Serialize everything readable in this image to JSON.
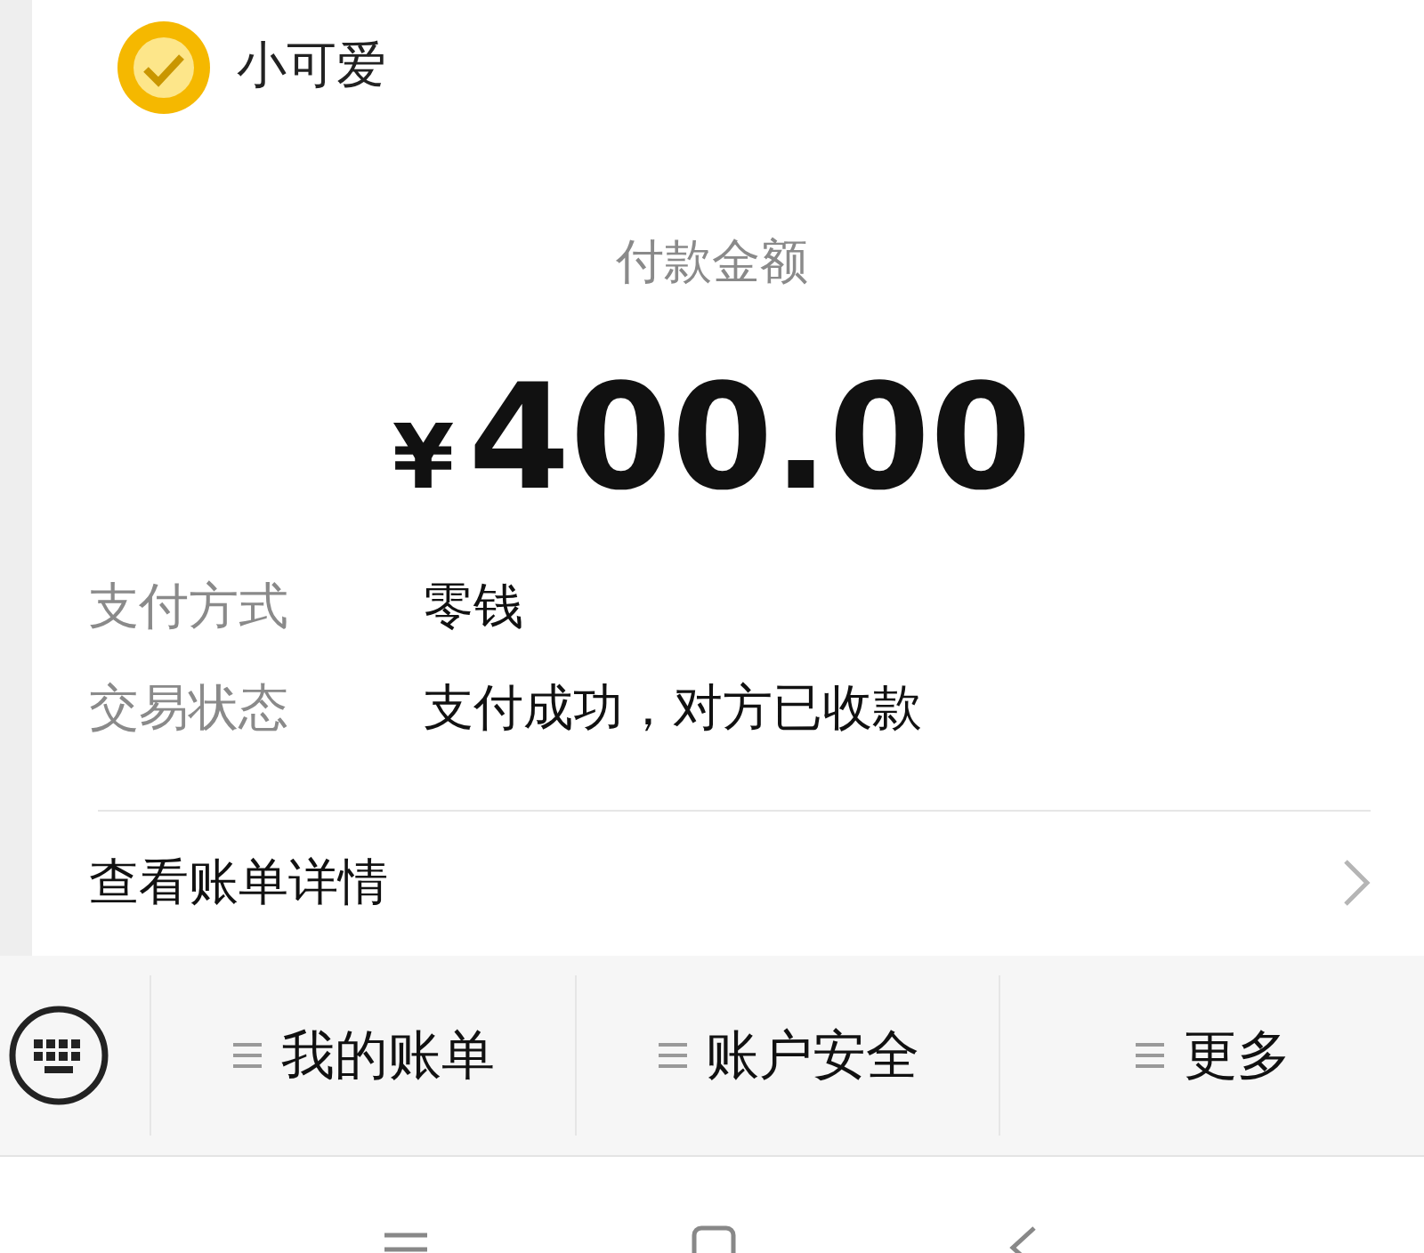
{
  "merchant": {
    "name": "小可爱"
  },
  "payment": {
    "label": "付款金额",
    "currency": "¥",
    "amount": "400.00"
  },
  "details": [
    {
      "label": "支付方式",
      "value": "零钱"
    },
    {
      "label": "交易状态",
      "value": "支付成功，对方已收款"
    }
  ],
  "bill_link": {
    "label": "查看账单详情"
  },
  "menu": [
    {
      "label": "我的账单"
    },
    {
      "label": "账户安全"
    },
    {
      "label": "更多"
    }
  ]
}
